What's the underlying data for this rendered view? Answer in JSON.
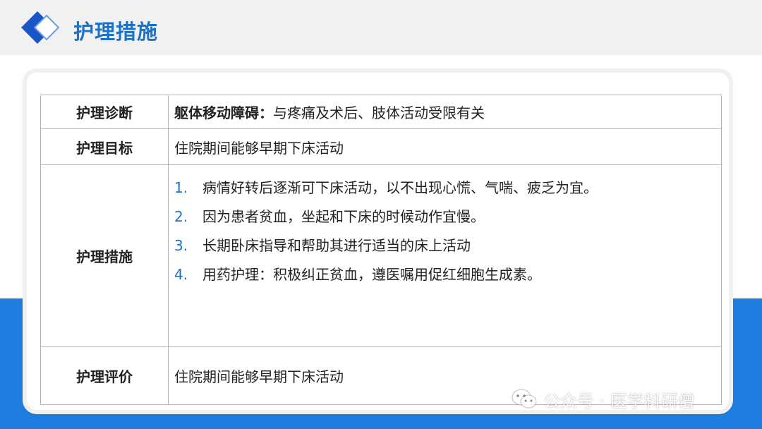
{
  "header": {
    "title": "护理措施"
  },
  "table": {
    "rows": [
      {
        "label": "护理诊断",
        "lead": "躯体移动障碍：",
        "text": "与疼痛及术后、肢体活动受限有关"
      },
      {
        "label": "护理目标",
        "text": "住院期间能够早期下床活动"
      },
      {
        "label": "护理措施",
        "items": [
          {
            "num": "1.",
            "text": "病情好转后逐渐可下床活动，以不出现心慌、气喘、疲乏为宜。"
          },
          {
            "num": "2.",
            "text": "因为患者贫血，坐起和下床的时候动作宜慢。"
          },
          {
            "num": "3.",
            "text": "长期卧床指导和帮助其进行适当的床上活动"
          },
          {
            "num": "4.",
            "text": "用药护理：积极纠正贫血，遵医嘱用促红细胞生成素。"
          }
        ]
      },
      {
        "label": "护理评价",
        "text": "住院期间能够早期下床活动"
      }
    ]
  },
  "watermark": {
    "text": "公众号 · 医学科研僧"
  },
  "colors": {
    "accent": "#1a73c8",
    "band": "#1e7fe0",
    "header_bg": "#f1f1f1"
  },
  "icons": {
    "logo": "double-diamond-icon",
    "watermark": "wechat-icon"
  }
}
